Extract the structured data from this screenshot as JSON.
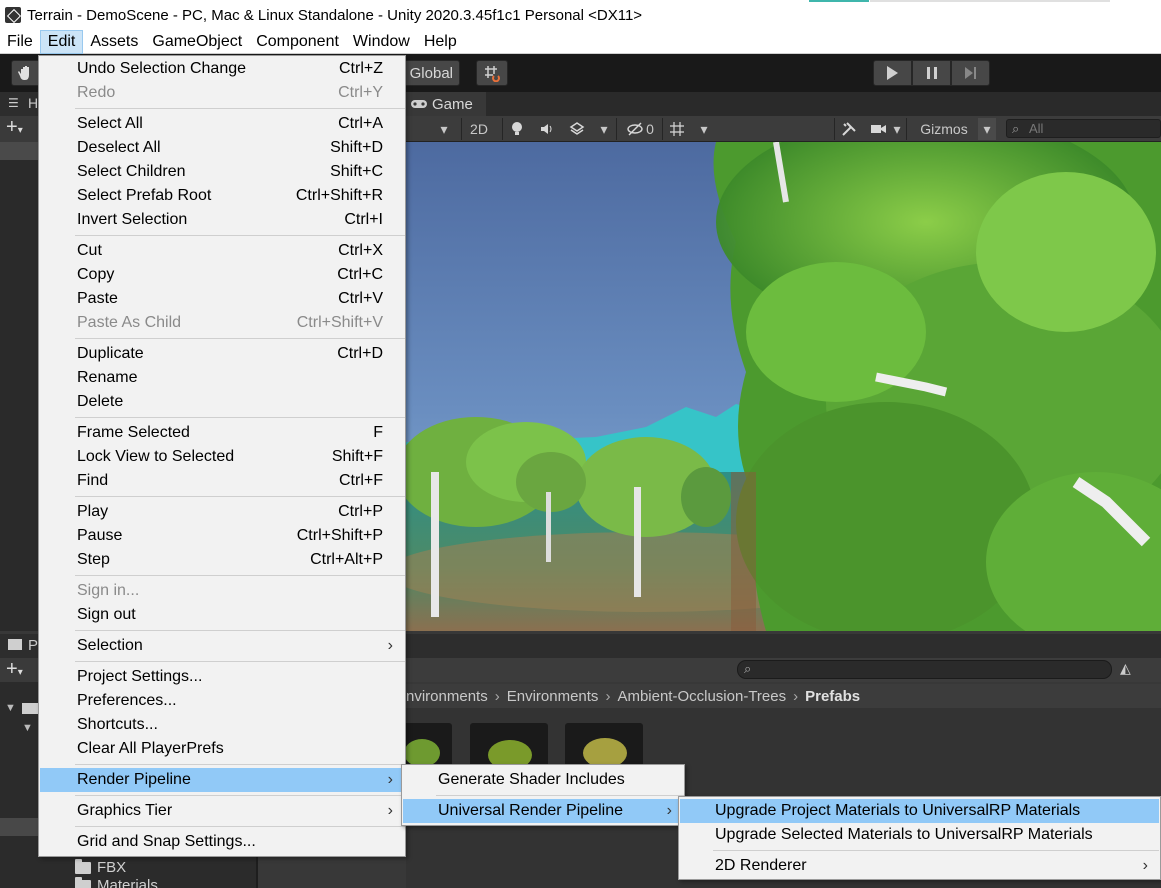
{
  "window": {
    "title": "Terrain - DemoScene - PC, Mac & Linux Standalone - Unity 2020.3.45f1c1 Personal <DX11>"
  },
  "menubar": {
    "items": [
      "File",
      "Edit",
      "Assets",
      "GameObject",
      "Component",
      "Window",
      "Help"
    ]
  },
  "toolbar": {
    "global_label": "Global"
  },
  "hierarchy": {
    "tab_label": "H"
  },
  "project": {
    "tab_label": "P"
  },
  "game_view": {
    "tab_label": "Game",
    "mode_2d": "2D",
    "hidden_count": "0",
    "gizmos_label": "Gizmos",
    "search_placeholder": "All"
  },
  "edit_menu": {
    "items": [
      {
        "label": "Undo Selection Change",
        "shortcut": "Ctrl+Z"
      },
      {
        "label": "Redo",
        "shortcut": "Ctrl+Y"
      },
      {
        "label": "Select All",
        "shortcut": "Ctrl+A"
      },
      {
        "label": "Deselect All",
        "shortcut": "Shift+D"
      },
      {
        "label": "Select Children",
        "shortcut": "Shift+C"
      },
      {
        "label": "Select Prefab Root",
        "shortcut": "Ctrl+Shift+R"
      },
      {
        "label": "Invert Selection",
        "shortcut": "Ctrl+I"
      },
      {
        "label": "Cut",
        "shortcut": "Ctrl+X"
      },
      {
        "label": "Copy",
        "shortcut": "Ctrl+C"
      },
      {
        "label": "Paste",
        "shortcut": "Ctrl+V"
      },
      {
        "label": "Paste As Child",
        "shortcut": "Ctrl+Shift+V"
      },
      {
        "label": "Duplicate",
        "shortcut": "Ctrl+D"
      },
      {
        "label": "Rename",
        "shortcut": ""
      },
      {
        "label": "Delete",
        "shortcut": ""
      },
      {
        "label": "Frame Selected",
        "shortcut": "F"
      },
      {
        "label": "Lock View to Selected",
        "shortcut": "Shift+F"
      },
      {
        "label": "Find",
        "shortcut": "Ctrl+F"
      },
      {
        "label": "Play",
        "shortcut": "Ctrl+P"
      },
      {
        "label": "Pause",
        "shortcut": "Ctrl+Shift+P"
      },
      {
        "label": "Step",
        "shortcut": "Ctrl+Alt+P"
      },
      {
        "label": "Sign in...",
        "shortcut": ""
      },
      {
        "label": "Sign out",
        "shortcut": ""
      },
      {
        "label": "Selection",
        "shortcut": ""
      },
      {
        "label": "Project Settings...",
        "shortcut": ""
      },
      {
        "label": "Preferences...",
        "shortcut": ""
      },
      {
        "label": "Shortcuts...",
        "shortcut": ""
      },
      {
        "label": "Clear All PlayerPrefs",
        "shortcut": ""
      },
      {
        "label": "Render Pipeline",
        "shortcut": ""
      },
      {
        "label": "Graphics Tier",
        "shortcut": ""
      },
      {
        "label": "Grid and Snap Settings...",
        "shortcut": ""
      }
    ]
  },
  "render_pipeline_submenu": {
    "items": [
      "Generate Shader Includes",
      "Universal Render Pipeline"
    ]
  },
  "urp_submenu": {
    "items": [
      "Upgrade Project Materials to UniversalRP Materials",
      "Upgrade Selected Materials to UniversalRP Materials",
      "2D Renderer"
    ]
  },
  "breadcrumb": {
    "items": [
      "Environments",
      "Environments",
      "Ambient-Occlusion-Trees",
      "Prefabs"
    ]
  },
  "project_tree": {
    "folders": [
      "FBX",
      "Materials"
    ]
  },
  "icons": {
    "arrow": "›"
  }
}
